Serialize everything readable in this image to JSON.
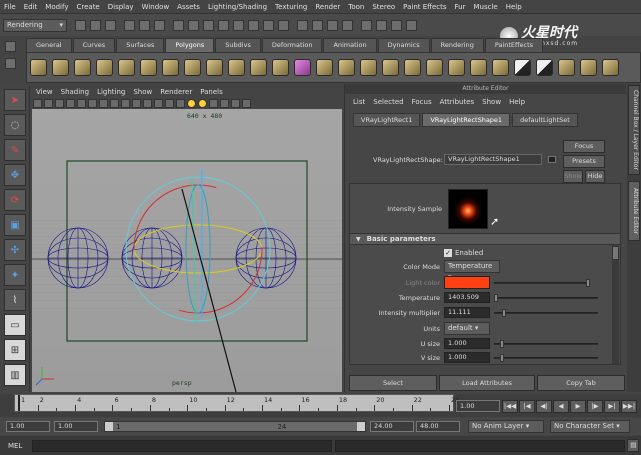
{
  "menubar": [
    "File",
    "Edit",
    "Modify",
    "Create",
    "Display",
    "Window",
    "Assets",
    "Lighting/Shading",
    "Texturing",
    "Render",
    "Toon",
    "Stereo",
    "Paint Effects",
    "Fur",
    "Muscle",
    "Help"
  ],
  "status": {
    "mode": "Rendering"
  },
  "watermark": {
    "brand": "火星时代",
    "url": "www.hxsd.com"
  },
  "shelf_tabs": [
    "General",
    "Curves",
    "Surfaces",
    "Polygons",
    "Subdivs",
    "Deformation",
    "Animation",
    "Dynamics",
    "Rendering",
    "PaintEffects"
  ],
  "shelf_active": "Polygons",
  "viewport": {
    "menu": [
      "View",
      "Shading",
      "Lighting",
      "Show",
      "Renderer",
      "Panels"
    ],
    "resolution": "640 x 480",
    "camera": "persp"
  },
  "attribute_editor": {
    "title": "Attribute Editor",
    "menu": [
      "List",
      "Selected",
      "Focus",
      "Attributes",
      "Show",
      "Help"
    ],
    "tabs": [
      "VRayLightRect1",
      "VRayLightRectShape1",
      "defaultLightSet"
    ],
    "active_tab": "VRayLightRectShape1",
    "shape_label": "VRayLightRectShape:",
    "shape_value": "VRayLightRectShape1",
    "focus_btn": "Focus",
    "presets_btn": "Presets",
    "show_btn": "Show",
    "hide_btn": "Hide",
    "intensity_sample": "Intensity Sample",
    "section": "Basic parameters",
    "enabled_label": "Enabled",
    "color_mode_label": "Color Mode",
    "color_mode_value": "Temperature",
    "light_color_label": "Light color",
    "light_color": "#ff4010",
    "temperature_label": "Temperature",
    "temperature_value": "1403.509",
    "intensity_mult_label": "Intensity multiplier",
    "intensity_mult_value": "11.111",
    "units_label": "Units",
    "units_value": "default",
    "usize_label": "U size",
    "usize_value": "1.000",
    "vsize_label": "V size",
    "vsize_value": "1.000",
    "bottom_buttons": [
      "Select",
      "Load Attributes",
      "Copy Tab"
    ]
  },
  "side_tabs": [
    "Channel Box / Layer Editor",
    "Attribute Editor"
  ],
  "time_slider": {
    "ticks": [
      "1",
      "2",
      "4",
      "6",
      "8",
      "10",
      "12",
      "14",
      "16",
      "18",
      "20",
      "22",
      "24"
    ],
    "current_frame": "1.00"
  },
  "range_slider": {
    "start": "1.00",
    "start_inner": "1.00",
    "range_start_label": "1",
    "range_end_label": "24",
    "end_inner": "24.00",
    "end": "48.00",
    "anim_layer": "No Anim Layer",
    "character_set": "No Character Set"
  },
  "command_line": {
    "label": "MEL"
  }
}
